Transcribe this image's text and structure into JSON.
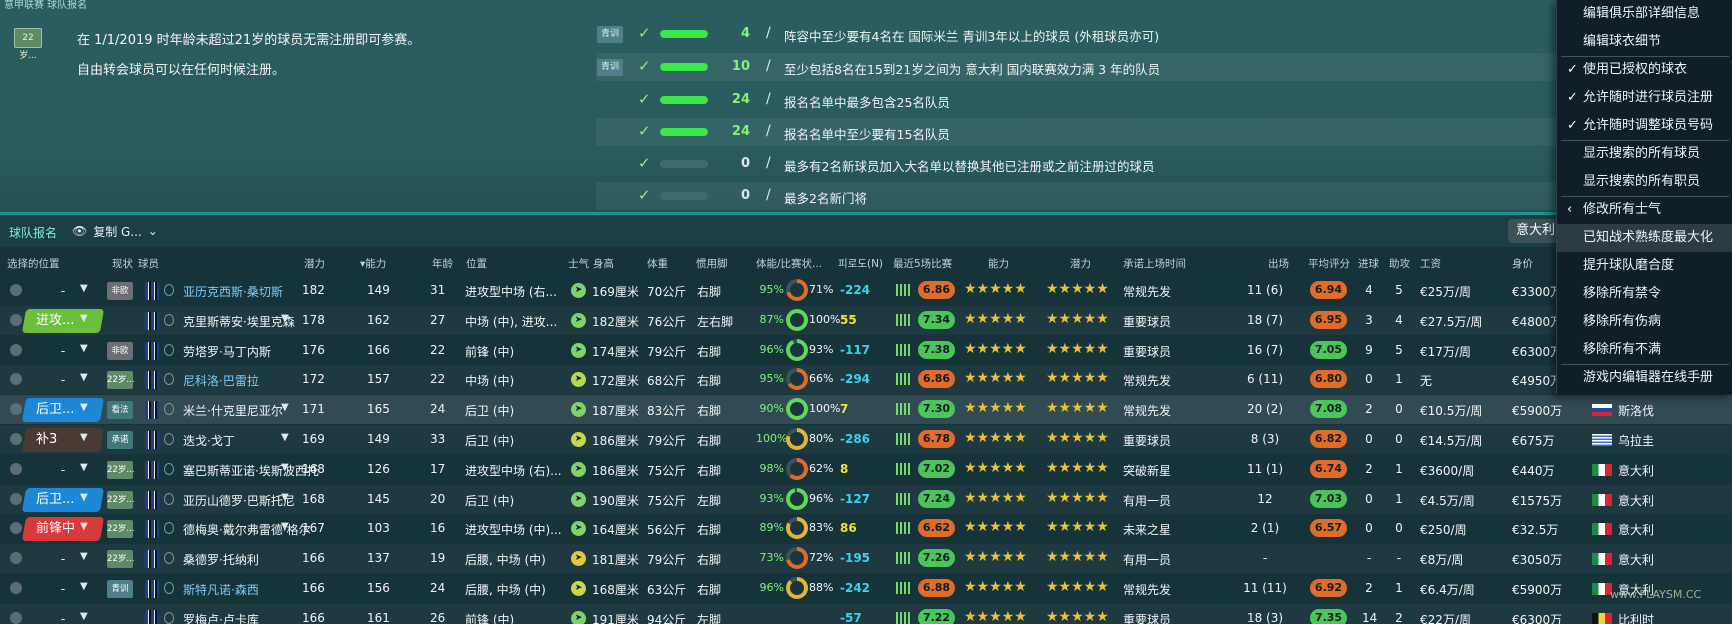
{
  "header": {
    "title": "意甲联赛 球队报名",
    "age_badge": "22岁...",
    "notes": [
      "在 1/1/2019 时年龄未超过21岁的球员无需注册即可参赛。",
      "自由转会球员可以在任何时候注册。"
    ]
  },
  "rules": [
    {
      "tag": "青训",
      "value": "4",
      "progress": 1.0,
      "text": "阵容中至少要有4名在 国际米兰 青训3年以上的球员 (外租球员亦可)"
    },
    {
      "tag": "青训",
      "value": "10",
      "progress": 1.0,
      "text": "至少包括8名在15到21岁之间为 意大利 国内联赛效力满 3 年的队员"
    },
    {
      "tag": "",
      "value": "24",
      "progress": 1.0,
      "text": "报名名单中最多包含25名队员"
    },
    {
      "tag": "",
      "value": "24",
      "progress": 1.0,
      "text": "报名名单中至少要有15名队员"
    },
    {
      "tag": "",
      "value": "0",
      "progress": 0.0,
      "text": "最多有2名新球员加入大名单以替换其他已注册或之前注册过的球员"
    },
    {
      "tag": "",
      "value": "0",
      "progress": 0.0,
      "text": "最多2名新门将"
    }
  ],
  "toolbar": {
    "title": "球队报名",
    "copy_label": "复制 G...",
    "right_label": "意大利"
  },
  "columns": {
    "sel": "选择的位置",
    "status": "现状",
    "player": "球员",
    "pot": "潜力",
    "abi": "能力",
    "age": "年龄",
    "pos": "位置",
    "morale": "士气",
    "height": "身高",
    "weight": "体重",
    "foot": "惯用脚",
    "condition": "体能/比赛状...",
    "sharpness": "피로도(N)",
    "last5": "最近5场比赛",
    "ability": "能力",
    "potential": "潜力",
    "role": "承诺上场时间",
    "apps": "出场",
    "avg": "平均评分",
    "goals": "进球",
    "assists": "助攻",
    "wage": "工资",
    "value": "身价"
  },
  "players": [
    {
      "sel": "-",
      "sel_type": "blank",
      "status": "非欧",
      "name": "亚历克西斯·桑切斯",
      "link": true,
      "pot": "182",
      "abi": "149",
      "age": "31",
      "pos": "进攻型中场 (右...",
      "height": "169厘米",
      "weight": "70公斤",
      "foot": "右脚",
      "cond": "95%",
      "sharp": "71%",
      "val": "-224",
      "last5": "6.86",
      "stars": "★★★★★",
      "stars2": "★★★★★",
      "role": "常规先发",
      "apps": "11 (6)",
      "avg": "6.94",
      "goals": "4",
      "assists": "5",
      "wage": "€25万/周",
      "value": "€3300万",
      "nat": ""
    },
    {
      "sel": "进攻...",
      "sel_type": "green",
      "status": "",
      "name": "克里斯蒂安·埃里克森",
      "link": false,
      "pot": "178",
      "abi": "162",
      "age": "27",
      "pos": "中场 (中), 进攻...",
      "height": "182厘米",
      "weight": "76公斤",
      "foot": "左右脚",
      "cond": "87%",
      "sharp": "100%",
      "val": "55",
      "last5": "7.34",
      "stars": "★★★★★",
      "stars2": "★★★★★",
      "role": "重要球员",
      "apps": "18 (7)",
      "avg": "6.95",
      "goals": "3",
      "assists": "4",
      "wage": "€27.5万/周",
      "value": "€4800万",
      "nat": ""
    },
    {
      "sel": "-",
      "sel_type": "blank",
      "status": "非欧",
      "name": "劳塔罗·马丁内斯",
      "link": false,
      "pot": "176",
      "abi": "166",
      "age": "22",
      "pos": "前锋 (中)",
      "height": "174厘米",
      "weight": "79公斤",
      "foot": "右脚",
      "cond": "96%",
      "sharp": "93%",
      "val": "-117",
      "last5": "7.38",
      "stars": "★★★★★",
      "stars2": "★★★★★",
      "role": "重要球员",
      "apps": "16 (7)",
      "avg": "7.05",
      "goals": "9",
      "assists": "5",
      "wage": "€17万/周",
      "value": "€6300万",
      "nat": ""
    },
    {
      "sel": "-",
      "sel_type": "blank",
      "status": "22岁...",
      "name": "尼科洛·巴雷拉",
      "link": true,
      "pot": "172",
      "abi": "157",
      "age": "22",
      "pos": "中场 (中)",
      "height": "172厘米",
      "weight": "68公斤",
      "foot": "右脚",
      "cond": "95%",
      "sharp": "66%",
      "val": "-294",
      "last5": "6.86",
      "stars": "★★★★★",
      "stars2": "★★★★★",
      "role": "常规先发",
      "apps": "6 (11)",
      "avg": "6.80",
      "goals": "0",
      "assists": "1",
      "wage": "无",
      "value": "€4950万",
      "nat": ""
    },
    {
      "sel": "后卫...",
      "sel_type": "blue",
      "status": "看法",
      "name": "米兰·什克里尼亚尔",
      "link": false,
      "pot": "171",
      "abi": "165",
      "age": "24",
      "pos": "后卫 (中)",
      "height": "187厘米",
      "weight": "83公斤",
      "foot": "右脚",
      "cond": "90%",
      "sharp": "100%",
      "val": "7",
      "last5": "7.30",
      "stars": "★★★★★",
      "stars2": "★★★★★",
      "role": "常规先发",
      "apps": "20 (2)",
      "avg": "7.08",
      "goals": "2",
      "assists": "0",
      "wage": "€10.5万/周",
      "value": "€5900万",
      "nat": "斯洛伐"
    },
    {
      "sel": "补3",
      "sel_type": "brown",
      "status": "承诺",
      "name": "迭戈·戈丁",
      "link": false,
      "pot": "169",
      "abi": "149",
      "age": "33",
      "pos": "后卫 (中)",
      "height": "186厘米",
      "weight": "79公斤",
      "foot": "右脚",
      "cond": "100%",
      "sharp": "80%",
      "val": "-286",
      "last5": "6.78",
      "stars": "★★★★★",
      "stars2": "★★★★★",
      "role": "重要球员",
      "apps": "8 (3)",
      "avg": "6.82",
      "goals": "0",
      "assists": "0",
      "wage": "€14.5万/周",
      "value": "€675万",
      "nat": "乌拉圭"
    },
    {
      "sel": "-",
      "sel_type": "blank",
      "status": "22岁...",
      "name": "塞巴斯蒂亚诺·埃斯波西托",
      "link": false,
      "pot": "168",
      "abi": "126",
      "age": "17",
      "pos": "进攻型中场 (右)...",
      "height": "186厘米",
      "weight": "75公斤",
      "foot": "右脚",
      "cond": "98%",
      "sharp": "62%",
      "val": "8",
      "last5": "7.02",
      "stars": "★★★★★",
      "stars2": "★★★★★",
      "role": "突破新星",
      "apps": "11 (1)",
      "avg": "6.74",
      "goals": "2",
      "assists": "1",
      "wage": "€3600/周",
      "value": "€440万",
      "nat": "意大利"
    },
    {
      "sel": "后卫...",
      "sel_type": "blue",
      "status": "22岁...",
      "name": "亚历山德罗·巴斯托尼",
      "link": false,
      "pot": "168",
      "abi": "145",
      "age": "20",
      "pos": "后卫 (中)",
      "height": "190厘米",
      "weight": "75公斤",
      "foot": "左脚",
      "cond": "93%",
      "sharp": "96%",
      "val": "-127",
      "last5": "7.24",
      "stars": "★★★★★",
      "stars2": "★★★★★",
      "role": "有用一员",
      "apps": "12",
      "avg": "7.03",
      "goals": "0",
      "assists": "1",
      "wage": "€4.5万/周",
      "value": "€1575万",
      "nat": "意大利"
    },
    {
      "sel": "前锋中",
      "sel_type": "red",
      "status": "22岁...",
      "name": "德梅奥·戴尔弗雷德·格尔",
      "link": false,
      "pot": "167",
      "abi": "103",
      "age": "16",
      "pos": "进攻型中场 (中)...",
      "height": "164厘米",
      "weight": "56公斤",
      "foot": "右脚",
      "cond": "89%",
      "sharp": "83%",
      "val": "86",
      "last5": "6.62",
      "stars": "★★★★★",
      "stars2": "★★★★★",
      "role": "未来之星",
      "apps": "2 (1)",
      "avg": "6.57",
      "goals": "0",
      "assists": "0",
      "wage": "€250/周",
      "value": "€32.5万",
      "nat": "意大利"
    },
    {
      "sel": "-",
      "sel_type": "blank",
      "status": "22岁...",
      "name": "桑德罗·托纳利",
      "link": false,
      "pot": "166",
      "abi": "137",
      "age": "19",
      "pos": "后腰, 中场 (中)",
      "height": "181厘米",
      "weight": "79公斤",
      "foot": "右脚",
      "cond": "73%",
      "sharp": "72%",
      "val": "-195",
      "last5": "7.26",
      "stars": "★★★★★",
      "stars2": "★★★★★",
      "role": "有用一员",
      "apps": "-",
      "avg": "",
      "goals": "-",
      "assists": "-",
      "wage": "€8万/周",
      "value": "€3050万",
      "nat": "意大利"
    },
    {
      "sel": "-",
      "sel_type": "blank",
      "status": "青训",
      "name": "斯特凡诺·森西",
      "link": true,
      "pot": "166",
      "abi": "156",
      "age": "24",
      "pos": "后腰, 中场 (中)",
      "height": "168厘米",
      "weight": "63公斤",
      "foot": "右脚",
      "cond": "96%",
      "sharp": "88%",
      "val": "-242",
      "last5": "6.88",
      "stars": "★★★★★",
      "stars2": "★★★★★",
      "role": "常规先发",
      "apps": "11 (11)",
      "avg": "6.92",
      "goals": "2",
      "assists": "1",
      "wage": "€6.4万/周",
      "value": "€5900万",
      "nat": "意大利"
    },
    {
      "sel": "-",
      "sel_type": "blank",
      "status": "",
      "name": "罗梅卢·卢卡库",
      "link": false,
      "pot": "166",
      "abi": "161",
      "age": "26",
      "pos": "前锋 (中)",
      "height": "191厘米",
      "weight": "94公斤",
      "foot": "左脚",
      "cond": "",
      "sharp": "",
      "val": "-57",
      "last5": "7.22",
      "stars": "★★★★★",
      "stars2": "★★★★★",
      "role": "重要球员",
      "apps": "18 (3)",
      "avg": "7.35",
      "goals": "14",
      "assists": "2",
      "wage": "€22万/周",
      "value": "€6300万",
      "nat": "比利时"
    }
  ],
  "menu": {
    "items": [
      {
        "label": "编辑俱乐部详细信息",
        "checked": false
      },
      {
        "label": "编辑球衣细节",
        "checked": false
      },
      {
        "label": "使用已授权的球衣",
        "checked": true
      },
      {
        "label": "允许随时进行球员注册",
        "checked": true
      },
      {
        "label": "允许随时调整球员号码",
        "checked": true
      },
      {
        "label": "显示搜索的所有球员",
        "checked": false
      },
      {
        "label": "显示搜索的所有职员",
        "checked": false
      },
      {
        "label": "修改所有士气",
        "checked": false
      },
      {
        "label": "已知战术熟练度最大化",
        "checked": false
      },
      {
        "label": "提升球队磨合度",
        "checked": false
      },
      {
        "label": "移除所有禁令",
        "checked": false
      },
      {
        "label": "移除所有伤病",
        "checked": false
      },
      {
        "label": "移除所有不满",
        "checked": false
      },
      {
        "label": "游戏内编辑器在线手册",
        "checked": false
      }
    ]
  },
  "colors": {
    "green": "#3be84a",
    "orange": "#e26b2a",
    "bg": "#17333a",
    "accent": "#1fb9b0"
  },
  "watermark": "www.PLAYSM.CC"
}
